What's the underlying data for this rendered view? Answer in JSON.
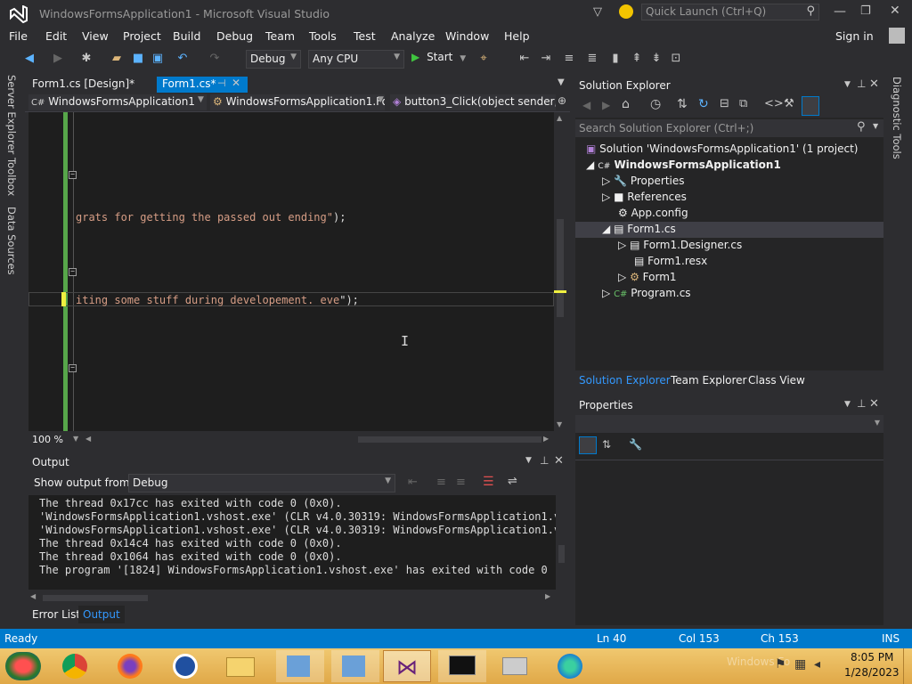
{
  "window": {
    "title": "WindowsFormsApplication1 - Microsoft Visual Studio",
    "quick_launch": "Quick Launch (Ctrl+Q)"
  },
  "menu": [
    "File",
    "Edit",
    "View",
    "Project",
    "Build",
    "Debug",
    "Team",
    "Tools",
    "Test",
    "Analyze",
    "Window",
    "Help"
  ],
  "sign_in": "Sign in",
  "toolbar": {
    "config": "Debug",
    "platform": "Any CPU",
    "start": "Start"
  },
  "side_tabs": [
    "Server Explorer",
    "Toolbox",
    "Data Sources"
  ],
  "right_side_tab": "Diagnostic Tools",
  "editor": {
    "tabs": [
      "Form1.cs [Design]*",
      "Form1.cs*"
    ],
    "nav": [
      "WindowsFormsApplication1",
      "WindowsFormsApplication1.Fo",
      "button3_Click(object sender, E"
    ],
    "lines": [
      {
        "str": "grats for getting the passed out ending\"",
        "tail": ");"
      },
      {
        "str": "iting some stuff during developement. eve",
        "tail": "\");"
      }
    ],
    "zoom": "100 %"
  },
  "output": {
    "title": "Output",
    "show_from_label": "Show output from:",
    "show_from_value": "Debug",
    "lines": [
      "The thread 0x17cc has exited with code 0 (0x0).",
      "'WindowsFormsApplication1.vshost.exe' (CLR v4.0.30319: WindowsFormsApplication1.vsh",
      "'WindowsFormsApplication1.vshost.exe' (CLR v4.0.30319: WindowsFormsApplication1.vsh",
      "The thread 0x14c4 has exited with code 0 (0x0).",
      "The thread 0x1064 has exited with code 0 (0x0).",
      "The program '[1824] WindowsFormsApplication1.vshost.exe' has exited with code 0 (0x"
    ],
    "tabs": [
      "Error List",
      "Output"
    ]
  },
  "solution_explorer": {
    "title": "Solution Explorer",
    "search": "Search Solution Explorer (Ctrl+;)",
    "tree": [
      "Solution 'WindowsFormsApplication1' (1 project)",
      "WindowsFormsApplication1",
      "Properties",
      "References",
      "App.config",
      "Form1.cs",
      "Form1.Designer.cs",
      "Form1.resx",
      "Form1",
      "Program.cs"
    ],
    "bottom_tabs": [
      "Solution Explorer",
      "Team Explorer",
      "Class View"
    ]
  },
  "properties": {
    "title": "Properties"
  },
  "status": {
    "ready": "Ready",
    "ln": "Ln 40",
    "col": "Col 153",
    "ch": "Ch 153",
    "mode": "INS"
  },
  "taskbar": {
    "time": "8:05 PM",
    "date": "1/28/2023",
    "watermark": "Windows Fo"
  },
  "colors": {
    "accent": "#007acc",
    "string": "#d69d85",
    "bg": "#2d2d30"
  }
}
